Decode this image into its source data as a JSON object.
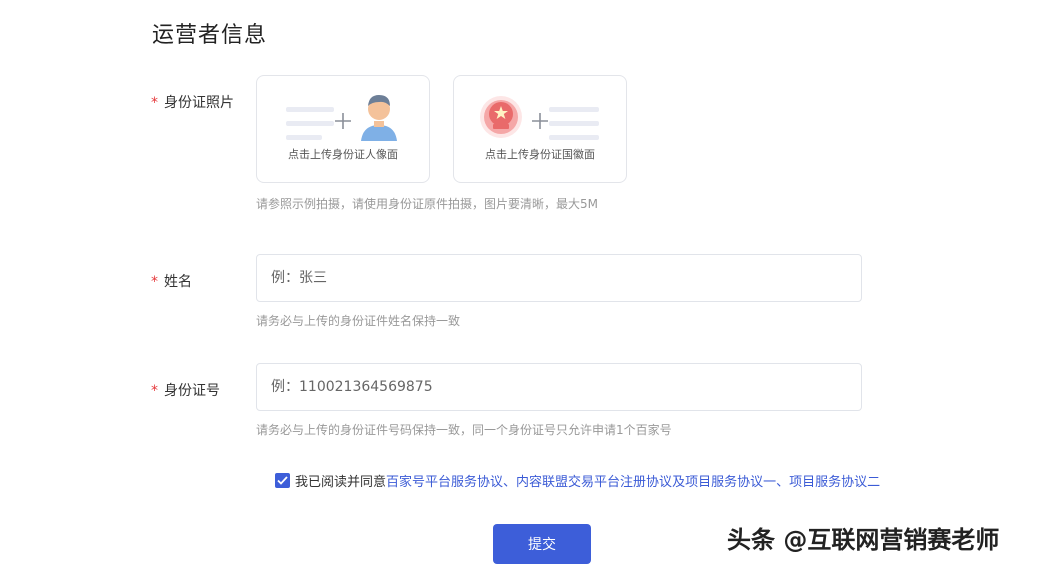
{
  "section": {
    "title": "运营者信息"
  },
  "id_photo": {
    "label": "身份证照片",
    "required_mark": "*",
    "front_caption": "点击上传身份证人像面",
    "back_caption": "点击上传身份证国徽面",
    "hint": "请参照示例拍摄，请使用身份证原件拍摄，图片要清晰，最大5M"
  },
  "name": {
    "label": "姓名",
    "required_mark": "*",
    "placeholder": "例：张三",
    "hint": "请务必与上传的身份证件姓名保持一致"
  },
  "id_number": {
    "label": "身份证号",
    "required_mark": "*",
    "placeholder": "例：110021364569875",
    "hint": "请务必与上传的身份证件号码保持一致，同一个身份证号只允许申请1个百家号"
  },
  "agreement": {
    "checked": true,
    "prefix": "我已阅读并同意",
    "link1": "百家号平台服务协议",
    "sep1": "、",
    "link2": "内容联盟交易平台注册协议",
    "sep2": "及",
    "link3": "项目服务协议一",
    "sep3": "、",
    "link4": "项目服务协议二"
  },
  "submit": {
    "label": "提交"
  },
  "watermark": {
    "text": "头条 @互联网营销赛老师"
  },
  "colors": {
    "accent": "#3d5ed9",
    "required": "#e5383b",
    "hint": "#999999",
    "link": "#3b5bd6"
  }
}
